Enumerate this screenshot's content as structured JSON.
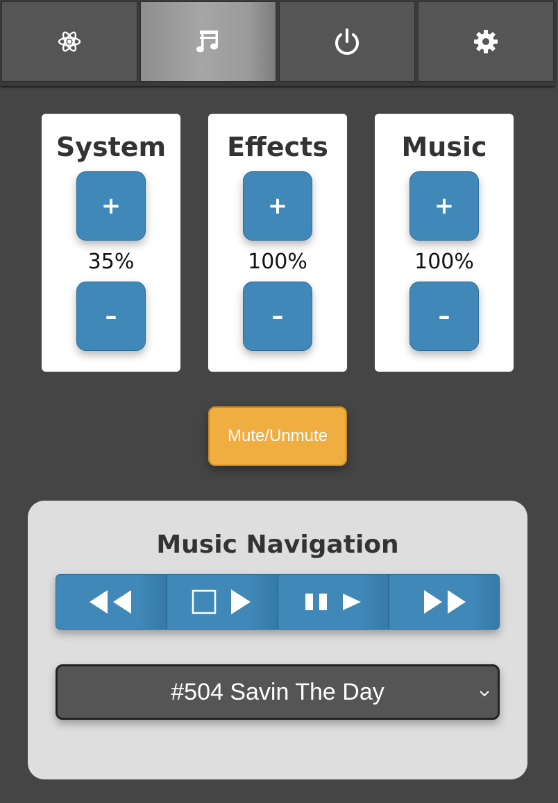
{
  "tabs": [
    {
      "name": "atom-icon",
      "active": false
    },
    {
      "name": "music-note-icon",
      "active": true
    },
    {
      "name": "power-icon",
      "active": false
    },
    {
      "name": "gear-icon",
      "active": false
    }
  ],
  "volume": {
    "system": {
      "title": "System",
      "plus_label": "+",
      "minus_label": "–",
      "value": "35%"
    },
    "effects": {
      "title": "Effects",
      "plus_label": "+",
      "minus_label": "–",
      "value": "100%"
    },
    "music": {
      "title": "Music",
      "plus_label": "+",
      "minus_label": "–",
      "value": "100%"
    }
  },
  "mute_label": "Mute/Unmute",
  "music_navigation": {
    "title": "Music Navigation",
    "buttons": [
      {
        "name": "previous-track-icon"
      },
      {
        "name": "stop-play-icon"
      },
      {
        "name": "pause-play-icon"
      },
      {
        "name": "next-track-icon"
      }
    ],
    "selected_track": "#504 Savin The Day"
  },
  "colors": {
    "background": "#454545",
    "tab": "#555555",
    "tab_active": "#a6a6a6",
    "button_blue": "#3f88b8",
    "mute_orange": "#f0ad40",
    "panel": "#dedede"
  }
}
